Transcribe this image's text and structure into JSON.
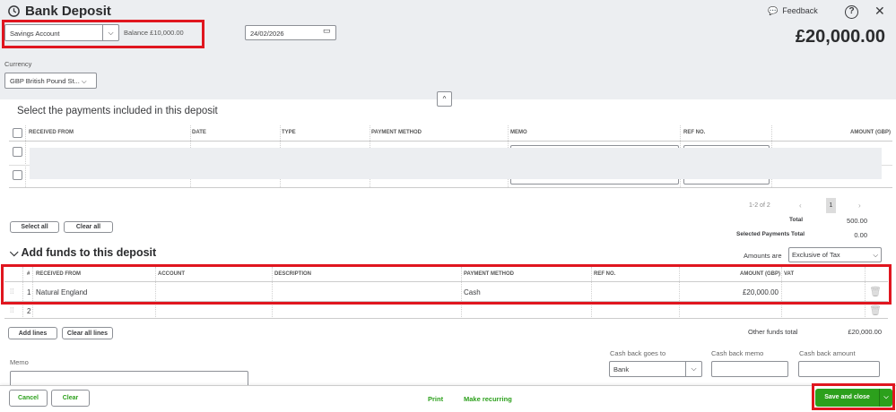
{
  "header": {
    "title": "Bank Deposit",
    "feedback": "Feedback",
    "total": "£20,000.00"
  },
  "account": {
    "value": "Savings Account",
    "balance": "Balance £10,000.00"
  },
  "date": "24/02/2026",
  "currency": {
    "label": "Currency",
    "value": "GBP British Pound St..."
  },
  "payments": {
    "title": "Select the payments included in this deposit",
    "columns": [
      "RECEIVED FROM",
      "DATE",
      "TYPE",
      "PAYMENT METHOD",
      "MEMO",
      "REF NO.",
      "AMOUNT (GBP)"
    ],
    "pagination": "1-2 of 2",
    "page": "1",
    "select_all": "Select all",
    "clear_all": "Clear all",
    "total_label": "Total",
    "total": "500.00",
    "selected_label": "Selected Payments Total",
    "selected": "0.00"
  },
  "funds": {
    "title": "Add funds to this deposit",
    "amounts_are_label": "Amounts are",
    "amounts_are": "Exclusive of Tax",
    "columns": [
      "#",
      "RECEIVED FROM",
      "ACCOUNT",
      "DESCRIPTION",
      "PAYMENT METHOD",
      "REF NO.",
      "AMOUNT (GBP)",
      "VAT"
    ],
    "rows": [
      {
        "num": "1",
        "received_from": "Natural England",
        "payment_method": "Cash",
        "amount": "£20,000.00"
      },
      {
        "num": "2",
        "received_from": "",
        "payment_method": "",
        "amount": ""
      }
    ],
    "add_lines": "Add lines",
    "clear_all_lines": "Clear all lines",
    "other_total_label": "Other funds total",
    "other_total": "£20,000.00"
  },
  "memo_label": "Memo",
  "cashback": {
    "goes_to_label": "Cash back goes to",
    "goes_to": "Bank",
    "memo_label": "Cash back memo",
    "amount_label": "Cash back amount"
  },
  "footer": {
    "cancel": "Cancel",
    "clear": "Clear",
    "print": "Print",
    "recurring": "Make recurring",
    "save": "Save and close"
  },
  "colors": {
    "accent": "#2ca01c",
    "highlight": "#e0161f"
  }
}
